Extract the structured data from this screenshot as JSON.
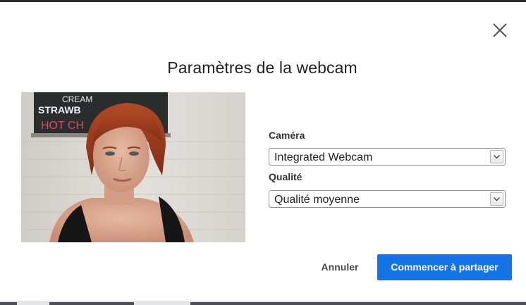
{
  "dialog": {
    "title": "Paramètres de la webcam",
    "close_icon": "close-icon"
  },
  "preview": {
    "board_lines": [
      "CREAM",
      "STRAWB",
      "HOT CH"
    ]
  },
  "camera": {
    "label": "Caméra",
    "selected": "Integrated Webcam"
  },
  "quality": {
    "label": "Qualité",
    "selected": "Qualité moyenne"
  },
  "actions": {
    "cancel_label": "Annuler",
    "start_label": "Commencer à partager"
  },
  "colors": {
    "primary": "#1473e6"
  }
}
